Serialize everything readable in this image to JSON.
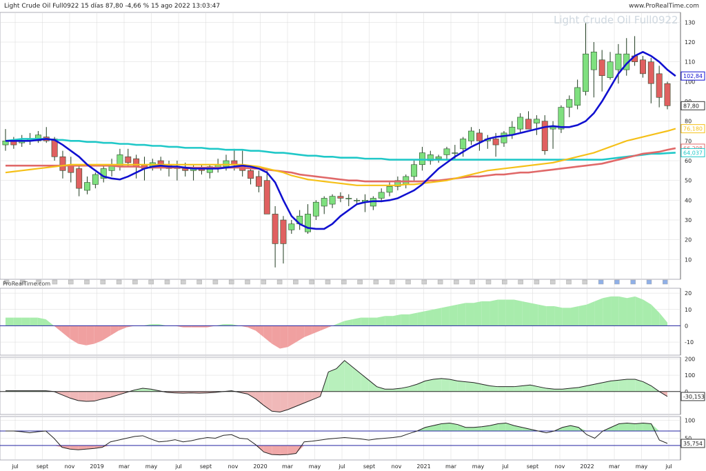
{
  "header": {
    "title": "Light Crude Oil Full0922 15 días 87,80 -4,66 % 15 ago 2022 13:03:47",
    "brand": "www.ProRealTime.com",
    "watermark": "Light Crude Oil Full0922",
    "panel_brand": "ProRealTime.com"
  },
  "colors": {
    "up": "#7fe07f",
    "down": "#e06060",
    "ma_fast": "#1010d0",
    "ma_mid": "#f5c018",
    "ma_slow": "#e06868",
    "ma_long": "#20c8c8",
    "grid": "#d8d8d8",
    "ref_line": "#2020a0"
  },
  "chart_data": [
    {
      "type": "candlestick",
      "x_labels": [
        "jul",
        "sept",
        "nov",
        "2019",
        "mar",
        "may",
        "jul",
        "sept",
        "nov",
        "2020",
        "mar",
        "may",
        "jul",
        "sept",
        "nov",
        "2021",
        "mar",
        "may",
        "jul",
        "sept",
        "nov",
        "2022",
        "mar",
        "may",
        "jul"
      ],
      "y_ticks": [
        10,
        20,
        30,
        40,
        50,
        60,
        70,
        80,
        90,
        100,
        110,
        120,
        130
      ],
      "ylim": [
        0,
        135
      ],
      "candles": [
        {
          "o": 68,
          "h": 76,
          "l": 65,
          "c": 70
        },
        {
          "o": 70,
          "h": 72,
          "l": 66,
          "c": 68
        },
        {
          "o": 69,
          "h": 73,
          "l": 67,
          "c": 70
        },
        {
          "o": 70,
          "h": 74,
          "l": 68,
          "c": 71
        },
        {
          "o": 70,
          "h": 75,
          "l": 69,
          "c": 73
        },
        {
          "o": 72,
          "h": 77,
          "l": 69,
          "c": 70
        },
        {
          "o": 71,
          "h": 72,
          "l": 60,
          "c": 62
        },
        {
          "o": 62,
          "h": 65,
          "l": 51,
          "c": 55
        },
        {
          "o": 58,
          "h": 62,
          "l": 49,
          "c": 54
        },
        {
          "o": 56,
          "h": 58,
          "l": 42,
          "c": 46
        },
        {
          "o": 45,
          "h": 52,
          "l": 43,
          "c": 49
        },
        {
          "o": 48,
          "h": 54,
          "l": 46,
          "c": 53
        },
        {
          "o": 51,
          "h": 58,
          "l": 49,
          "c": 56
        },
        {
          "o": 55,
          "h": 61,
          "l": 52,
          "c": 58
        },
        {
          "o": 57,
          "h": 66,
          "l": 55,
          "c": 63
        },
        {
          "o": 62,
          "h": 66,
          "l": 57,
          "c": 59
        },
        {
          "o": 61,
          "h": 63,
          "l": 51,
          "c": 57
        },
        {
          "o": 58,
          "h": 62,
          "l": 50,
          "c": 56
        },
        {
          "o": 57,
          "h": 61,
          "l": 55,
          "c": 59
        },
        {
          "o": 60,
          "h": 62,
          "l": 55,
          "c": 57
        },
        {
          "o": 58,
          "h": 60,
          "l": 52,
          "c": 56
        },
        {
          "o": 57,
          "h": 60,
          "l": 50,
          "c": 56
        },
        {
          "o": 56,
          "h": 59,
          "l": 52,
          "c": 55
        },
        {
          "o": 55,
          "h": 58,
          "l": 50,
          "c": 56
        },
        {
          "o": 56,
          "h": 58,
          "l": 53,
          "c": 55
        },
        {
          "o": 54,
          "h": 58,
          "l": 51,
          "c": 57
        },
        {
          "o": 56,
          "h": 61,
          "l": 54,
          "c": 58
        },
        {
          "o": 57,
          "h": 63,
          "l": 55,
          "c": 60
        },
        {
          "o": 60,
          "h": 66,
          "l": 55,
          "c": 58
        },
        {
          "o": 58,
          "h": 65,
          "l": 52,
          "c": 55
        },
        {
          "o": 55,
          "h": 57,
          "l": 48,
          "c": 51
        },
        {
          "o": 52,
          "h": 55,
          "l": 44,
          "c": 47
        },
        {
          "o": 50,
          "h": 55,
          "l": 42,
          "c": 33
        },
        {
          "o": 33,
          "h": 37,
          "l": 6,
          "c": 18
        },
        {
          "o": 30,
          "h": 32,
          "l": 8,
          "c": 18
        },
        {
          "o": 25,
          "h": 30,
          "l": 23,
          "c": 28
        },
        {
          "o": 28,
          "h": 35,
          "l": 25,
          "c": 32
        },
        {
          "o": 24,
          "h": 38,
          "l": 23,
          "c": 33
        },
        {
          "o": 32,
          "h": 40,
          "l": 30,
          "c": 39
        },
        {
          "o": 37,
          "h": 42,
          "l": 33,
          "c": 41
        },
        {
          "o": 38,
          "h": 43,
          "l": 36,
          "c": 42
        },
        {
          "o": 42,
          "h": 44,
          "l": 39,
          "c": 41
        },
        {
          "o": 41,
          "h": 43,
          "l": 37,
          "c": 41
        },
        {
          "o": 40,
          "h": 41,
          "l": 38,
          "c": 40
        },
        {
          "o": 39,
          "h": 43,
          "l": 34,
          "c": 40
        },
        {
          "o": 37,
          "h": 42,
          "l": 35,
          "c": 41
        },
        {
          "o": 41,
          "h": 46,
          "l": 39,
          "c": 44
        },
        {
          "o": 44,
          "h": 49,
          "l": 42,
          "c": 47
        },
        {
          "o": 47,
          "h": 52,
          "l": 45,
          "c": 50
        },
        {
          "o": 48,
          "h": 53,
          "l": 46,
          "c": 52
        },
        {
          "o": 52,
          "h": 60,
          "l": 50,
          "c": 58
        },
        {
          "o": 58,
          "h": 67,
          "l": 55,
          "c": 64
        },
        {
          "o": 60,
          "h": 65,
          "l": 58,
          "c": 63
        },
        {
          "o": 61,
          "h": 63,
          "l": 59,
          "c": 62
        },
        {
          "o": 63,
          "h": 67,
          "l": 60,
          "c": 66
        },
        {
          "o": 64,
          "h": 68,
          "l": 61,
          "c": 64
        },
        {
          "o": 66,
          "h": 72,
          "l": 62,
          "c": 71
        },
        {
          "o": 70,
          "h": 77,
          "l": 68,
          "c": 75
        },
        {
          "o": 74,
          "h": 76,
          "l": 65,
          "c": 70
        },
        {
          "o": 70,
          "h": 73,
          "l": 66,
          "c": 71
        },
        {
          "o": 71,
          "h": 74,
          "l": 62,
          "c": 68
        },
        {
          "o": 69,
          "h": 75,
          "l": 67,
          "c": 74
        },
        {
          "o": 73,
          "h": 80,
          "l": 71,
          "c": 77
        },
        {
          "o": 76,
          "h": 84,
          "l": 74,
          "c": 82
        },
        {
          "o": 81,
          "h": 85,
          "l": 78,
          "c": 76
        },
        {
          "o": 79,
          "h": 83,
          "l": 73,
          "c": 81
        },
        {
          "o": 80,
          "h": 83,
          "l": 63,
          "c": 65
        },
        {
          "o": 76,
          "h": 80,
          "l": 66,
          "c": 77
        },
        {
          "o": 76,
          "h": 88,
          "l": 74,
          "c": 87
        },
        {
          "o": 87,
          "h": 93,
          "l": 82,
          "c": 91
        },
        {
          "o": 88,
          "h": 101,
          "l": 86,
          "c": 97
        },
        {
          "o": 95,
          "h": 130,
          "l": 93,
          "c": 114
        },
        {
          "o": 106,
          "h": 120,
          "l": 92,
          "c": 115
        },
        {
          "o": 111,
          "h": 116,
          "l": 95,
          "c": 103
        },
        {
          "o": 102,
          "h": 115,
          "l": 101,
          "c": 110
        },
        {
          "o": 106,
          "h": 119,
          "l": 99,
          "c": 114
        },
        {
          "o": 106,
          "h": 122,
          "l": 103,
          "c": 114
        },
        {
          "o": 113,
          "h": 123,
          "l": 108,
          "c": 110
        },
        {
          "o": 111,
          "h": 113,
          "l": 102,
          "c": 104
        },
        {
          "o": 110,
          "h": 112,
          "l": 89,
          "c": 99
        },
        {
          "o": 104,
          "h": 108,
          "l": 87,
          "c": 92
        },
        {
          "o": 99,
          "h": 100,
          "l": 86,
          "c": 87.8
        }
      ],
      "moving_averages": [
        {
          "label": "102,84",
          "color_key": "ma_fast",
          "y": [
            70,
            70,
            70,
            70,
            70.5,
            71,
            70.5,
            68,
            65,
            62,
            58,
            55,
            52,
            51,
            50.5,
            52,
            54,
            56,
            57,
            57.5,
            57,
            57,
            56.5,
            56,
            56,
            56,
            56,
            56.5,
            57,
            57.5,
            57,
            56,
            54,
            49,
            40,
            32,
            28,
            26,
            25.5,
            25.5,
            28,
            32,
            35,
            38,
            39,
            39.5,
            39.5,
            40,
            41,
            43,
            45,
            48,
            52,
            56,
            59,
            62,
            64.5,
            67,
            69,
            71,
            72,
            72.5,
            73,
            74,
            75,
            76,
            77,
            77.5,
            77,
            77,
            78,
            80,
            84,
            90,
            97,
            104,
            109,
            113,
            115,
            113,
            110,
            106,
            102.84
          ]
        },
        {
          "label": "76,180",
          "color_key": "ma_mid",
          "y": [
            54,
            54.5,
            55,
            55.5,
            56,
            56.5,
            57,
            57.5,
            58,
            58,
            58,
            58,
            58,
            58,
            58,
            58,
            58,
            58,
            58,
            58,
            58,
            58,
            58,
            58,
            58,
            58,
            58,
            58,
            58,
            58,
            57.5,
            57,
            56,
            55,
            54,
            52.5,
            51.5,
            50.5,
            50,
            49.5,
            49,
            48.5,
            48,
            47.5,
            47.5,
            47.5,
            47.5,
            47.5,
            47.5,
            48,
            48,
            48.5,
            49,
            49.5,
            50,
            51,
            52,
            53,
            54,
            55,
            55.5,
            56,
            56.5,
            57,
            57.5,
            58,
            58.5,
            59,
            60,
            61,
            62,
            63,
            64,
            65.5,
            67,
            68.5,
            70,
            71,
            72,
            73,
            74,
            75,
            76.18
          ]
        },
        {
          "label": "66,298",
          "color_key": "ma_slow",
          "y": [
            57.5,
            57.5,
            57.5,
            57.5,
            57.5,
            57.5,
            57.5,
            57.5,
            57.5,
            57.5,
            57.5,
            57.5,
            57.5,
            57.5,
            57,
            57,
            57,
            56.5,
            56.5,
            56.5,
            56.5,
            56.5,
            56.5,
            56.5,
            56.5,
            56.5,
            56.5,
            56.5,
            56.5,
            56.5,
            56,
            56,
            55.5,
            55,
            54.5,
            54,
            53,
            52.5,
            52,
            51.5,
            51,
            50.5,
            50,
            50,
            49.5,
            49.5,
            49.5,
            49.5,
            49.5,
            49.5,
            49.5,
            49.5,
            50,
            50,
            50.5,
            51,
            51.5,
            52,
            52,
            52.5,
            53,
            53,
            53.5,
            54,
            54,
            54.5,
            55,
            55.5,
            56,
            56.5,
            57,
            57.5,
            58,
            58.5,
            59.5,
            60.5,
            61.5,
            62.5,
            63.5,
            64,
            64.5,
            65.5,
            66.298
          ]
        },
        {
          "label": "64,037",
          "color_key": "ma_long",
          "y": [
            70,
            70.5,
            71,
            71,
            71,
            71,
            70.5,
            70.5,
            70,
            70,
            69.5,
            69.5,
            69,
            69,
            68.5,
            68.5,
            68,
            68,
            67.5,
            67.5,
            67,
            67,
            66.5,
            66.5,
            66.5,
            66,
            66,
            65.5,
            65.5,
            65.5,
            65,
            65,
            64.5,
            64,
            64,
            63.5,
            63,
            62.5,
            62.5,
            62,
            62,
            61.5,
            61.5,
            61.5,
            61,
            61,
            61,
            60.5,
            60.5,
            60.5,
            60.5,
            60.5,
            60.5,
            60.5,
            60.5,
            60.5,
            60.5,
            60.5,
            60.5,
            60.5,
            60.5,
            60.5,
            60.5,
            60.5,
            60.5,
            60.5,
            60.5,
            60.5,
            60.5,
            60.5,
            60.5,
            60.5,
            60.5,
            60.5,
            61,
            61.5,
            62,
            62.5,
            63,
            63.5,
            63.5,
            63.8,
            64.037
          ]
        }
      ]
    },
    {
      "type": "area",
      "y_ticks": [
        20,
        10,
        0,
        -10
      ],
      "ylim": [
        -18,
        23
      ],
      "ref": 0,
      "series": [
        {
          "values": [
            5,
            5,
            5,
            5,
            5,
            4,
            0,
            -4,
            -8,
            -11,
            -12,
            -11,
            -9,
            -6,
            -3,
            -1,
            0,
            0,
            1,
            1,
            0,
            0,
            -1,
            -1,
            -1,
            -1,
            0,
            1,
            1,
            0,
            -1,
            -3,
            -7,
            -11,
            -14,
            -13,
            -10,
            -7,
            -5,
            -3,
            -1,
            1,
            3,
            4,
            5,
            5,
            5,
            6,
            6,
            7,
            7,
            8,
            9,
            10,
            11,
            12,
            13,
            14,
            14,
            15,
            15,
            16,
            16,
            16,
            15,
            14,
            13,
            12,
            12,
            11,
            11,
            12,
            13,
            15,
            17,
            18,
            18,
            17,
            18,
            16,
            13,
            8,
            2
          ]
        }
      ]
    },
    {
      "type": "area",
      "y_ticks": [
        200,
        100,
        0
      ],
      "ylim": [
        -140,
        210
      ],
      "ref": 0,
      "label": "-30,153",
      "series": [
        {
          "values": [
            5,
            5,
            5,
            5,
            5,
            5,
            0,
            -20,
            -40,
            -55,
            -60,
            -58,
            -45,
            -35,
            -20,
            -5,
            10,
            20,
            15,
            5,
            -5,
            -8,
            -10,
            -8,
            -10,
            -8,
            -5,
            0,
            5,
            -5,
            -15,
            -45,
            -85,
            -120,
            -125,
            -110,
            -90,
            -70,
            -50,
            -30,
            120,
            140,
            190,
            150,
            110,
            70,
            30,
            15,
            15,
            20,
            30,
            45,
            65,
            75,
            80,
            75,
            65,
            60,
            55,
            45,
            35,
            30,
            30,
            30,
            35,
            40,
            30,
            20,
            15,
            15,
            20,
            25,
            35,
            45,
            55,
            65,
            70,
            75,
            75,
            60,
            35,
            0,
            -30.153
          ]
        }
      ]
    },
    {
      "type": "area",
      "y_ticks": [
        100,
        50
      ],
      "ylim": [
        -10,
        110
      ],
      "ref_lines": [
        70,
        30
      ],
      "label": "35,754",
      "series": [
        {
          "values": [
            70,
            70,
            68,
            65,
            68,
            70,
            50,
            25,
            20,
            18,
            20,
            22,
            25,
            40,
            45,
            50,
            55,
            57,
            48,
            40,
            42,
            46,
            40,
            43,
            48,
            52,
            50,
            58,
            60,
            50,
            48,
            32,
            12,
            5,
            4,
            5,
            8,
            40,
            42,
            45,
            48,
            50,
            52,
            50,
            48,
            45,
            48,
            50,
            52,
            55,
            63,
            70,
            80,
            85,
            90,
            92,
            88,
            80,
            80,
            82,
            85,
            90,
            92,
            85,
            80,
            75,
            70,
            65,
            70,
            80,
            85,
            80,
            60,
            50,
            70,
            80,
            90,
            92,
            90,
            92,
            90,
            45,
            35.754
          ]
        }
      ]
    }
  ]
}
